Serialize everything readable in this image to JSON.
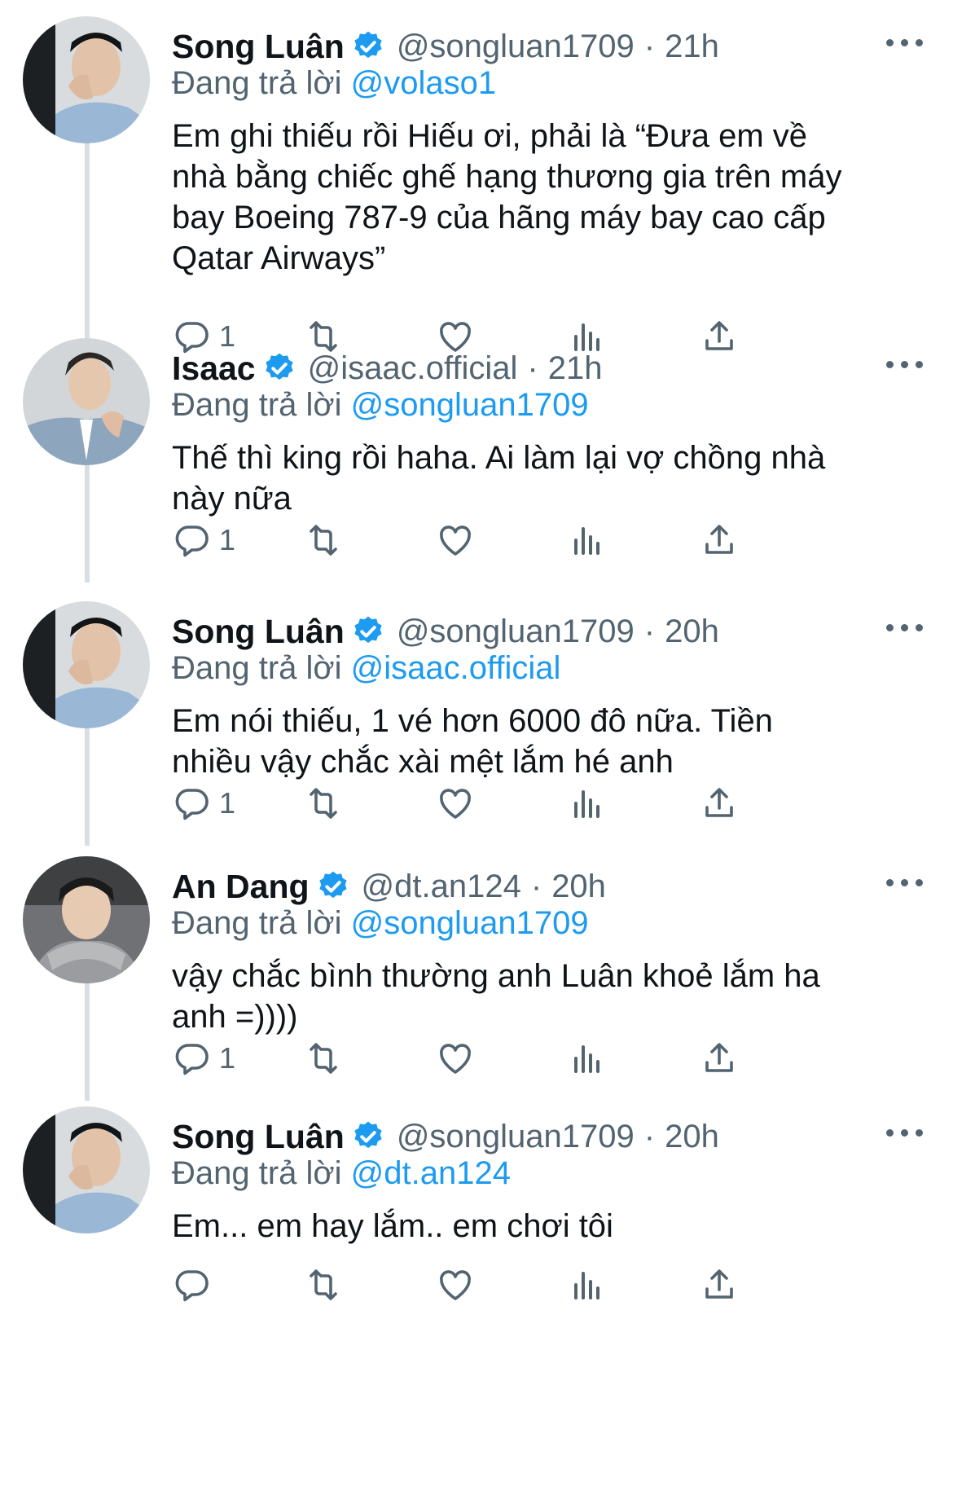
{
  "colors": {
    "link": "#1d9bf0",
    "muted": "#536471",
    "text": "#0f1419",
    "verified": "#1d9bf0",
    "thread_line": "#d9dee2"
  },
  "icons": {
    "verified": "verified-badge-icon",
    "more": "more-dots-icon",
    "reply": "reply-icon",
    "retweet": "retweet-icon",
    "like": "heart-icon",
    "analytics": "analytics-icon",
    "share": "share-icon"
  },
  "tweets": [
    {
      "name": "Song Luân",
      "handle": "@songluan1709",
      "sep": "·",
      "time": "21h",
      "reply_prefix": "Đang trả lời",
      "reply_to": "@volaso1",
      "lines": [
        "Em ghi thiếu rồi Hiếu ơi, phải là “Đưa em về",
        "nhà bằng chiếc ghế hạng thương gia trên máy",
        "bay Boeing 787-9 của hãng máy bay cao cấp",
        "Qatar Airways”"
      ],
      "reply_count": "1"
    },
    {
      "name": "Isaac",
      "handle": "@isaac.official",
      "sep": "·",
      "time": "21h",
      "reply_prefix": "Đang trả lời",
      "reply_to": "@songluan1709",
      "lines": [
        "Thế thì king rồi haha. Ai làm lại vợ chồng nhà",
        "này nữa"
      ],
      "reply_count": "1"
    },
    {
      "name": "Song Luân",
      "handle": "@songluan1709",
      "sep": "·",
      "time": "20h",
      "reply_prefix": "Đang trả lời",
      "reply_to": "@isaac.official",
      "lines": [
        "Em nói thiếu, 1 vé hơn 6000 đô nữa. Tiền",
        "nhiều vậy chắc xài mệt lắm hé anh"
      ],
      "reply_count": "1"
    },
    {
      "name": "An Dang",
      "handle": "@dt.an124",
      "sep": "·",
      "time": "20h",
      "reply_prefix": "Đang trả lời",
      "reply_to": "@songluan1709",
      "lines": [
        "vậy chắc bình thường anh Luân khoẻ lắm ha",
        "anh =))))"
      ],
      "reply_count": "1"
    },
    {
      "name": "Song Luân",
      "handle": "@songluan1709",
      "sep": "·",
      "time": "20h",
      "reply_prefix": "Đang trả lời",
      "reply_to": "@dt.an124",
      "lines": [
        "Em... em hay lắm.. em chơi tôi"
      ],
      "reply_count": ""
    }
  ]
}
